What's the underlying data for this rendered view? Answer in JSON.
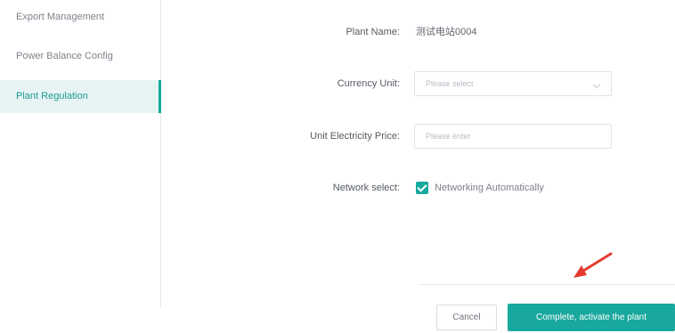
{
  "sidebar": {
    "items": [
      {
        "label": "Export Management",
        "active": false
      },
      {
        "label": "Power Balance Config",
        "active": false
      },
      {
        "label": "Plant Regulation",
        "active": true
      }
    ]
  },
  "form": {
    "plant_name": {
      "label": "Plant Name:",
      "value": "测试电站0004"
    },
    "currency_unit": {
      "label": "Currency Unit:",
      "placeholder": "Please select"
    },
    "electricity_price": {
      "label": "Unit Electricity Price:",
      "placeholder": "Please enter"
    },
    "network_select": {
      "label": "Network select:",
      "option_label": "Networking Automatically",
      "checked": true
    }
  },
  "footer": {
    "cancel_label": "Cancel",
    "primary_label": "Complete, activate the plant"
  },
  "colors": {
    "accent": "#19a89d",
    "active_bg": "#e7f4f3",
    "annotation_arrow": "#e53a2f"
  },
  "icons": {
    "dropdown": "chevron-down-icon",
    "checkbox": "check-icon",
    "annotation": "red-arrow-icon"
  }
}
